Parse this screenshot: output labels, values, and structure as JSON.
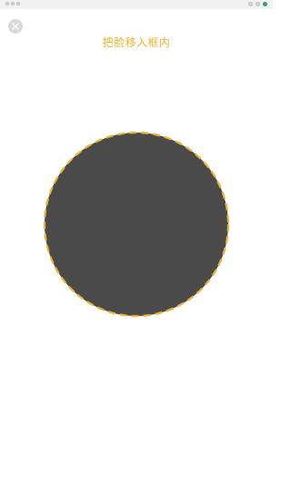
{
  "status_bar": {
    "icons": [
      "signal-icon",
      "wifi-icon",
      "battery-icon",
      "status-dot"
    ]
  },
  "header": {
    "close_icon": "close-icon",
    "prompt_text": "把脸移入框内"
  },
  "face_frame": {
    "fill_color": "#4a4a4a",
    "dash_color": "#f0b12c",
    "style": "dashed-circle"
  }
}
